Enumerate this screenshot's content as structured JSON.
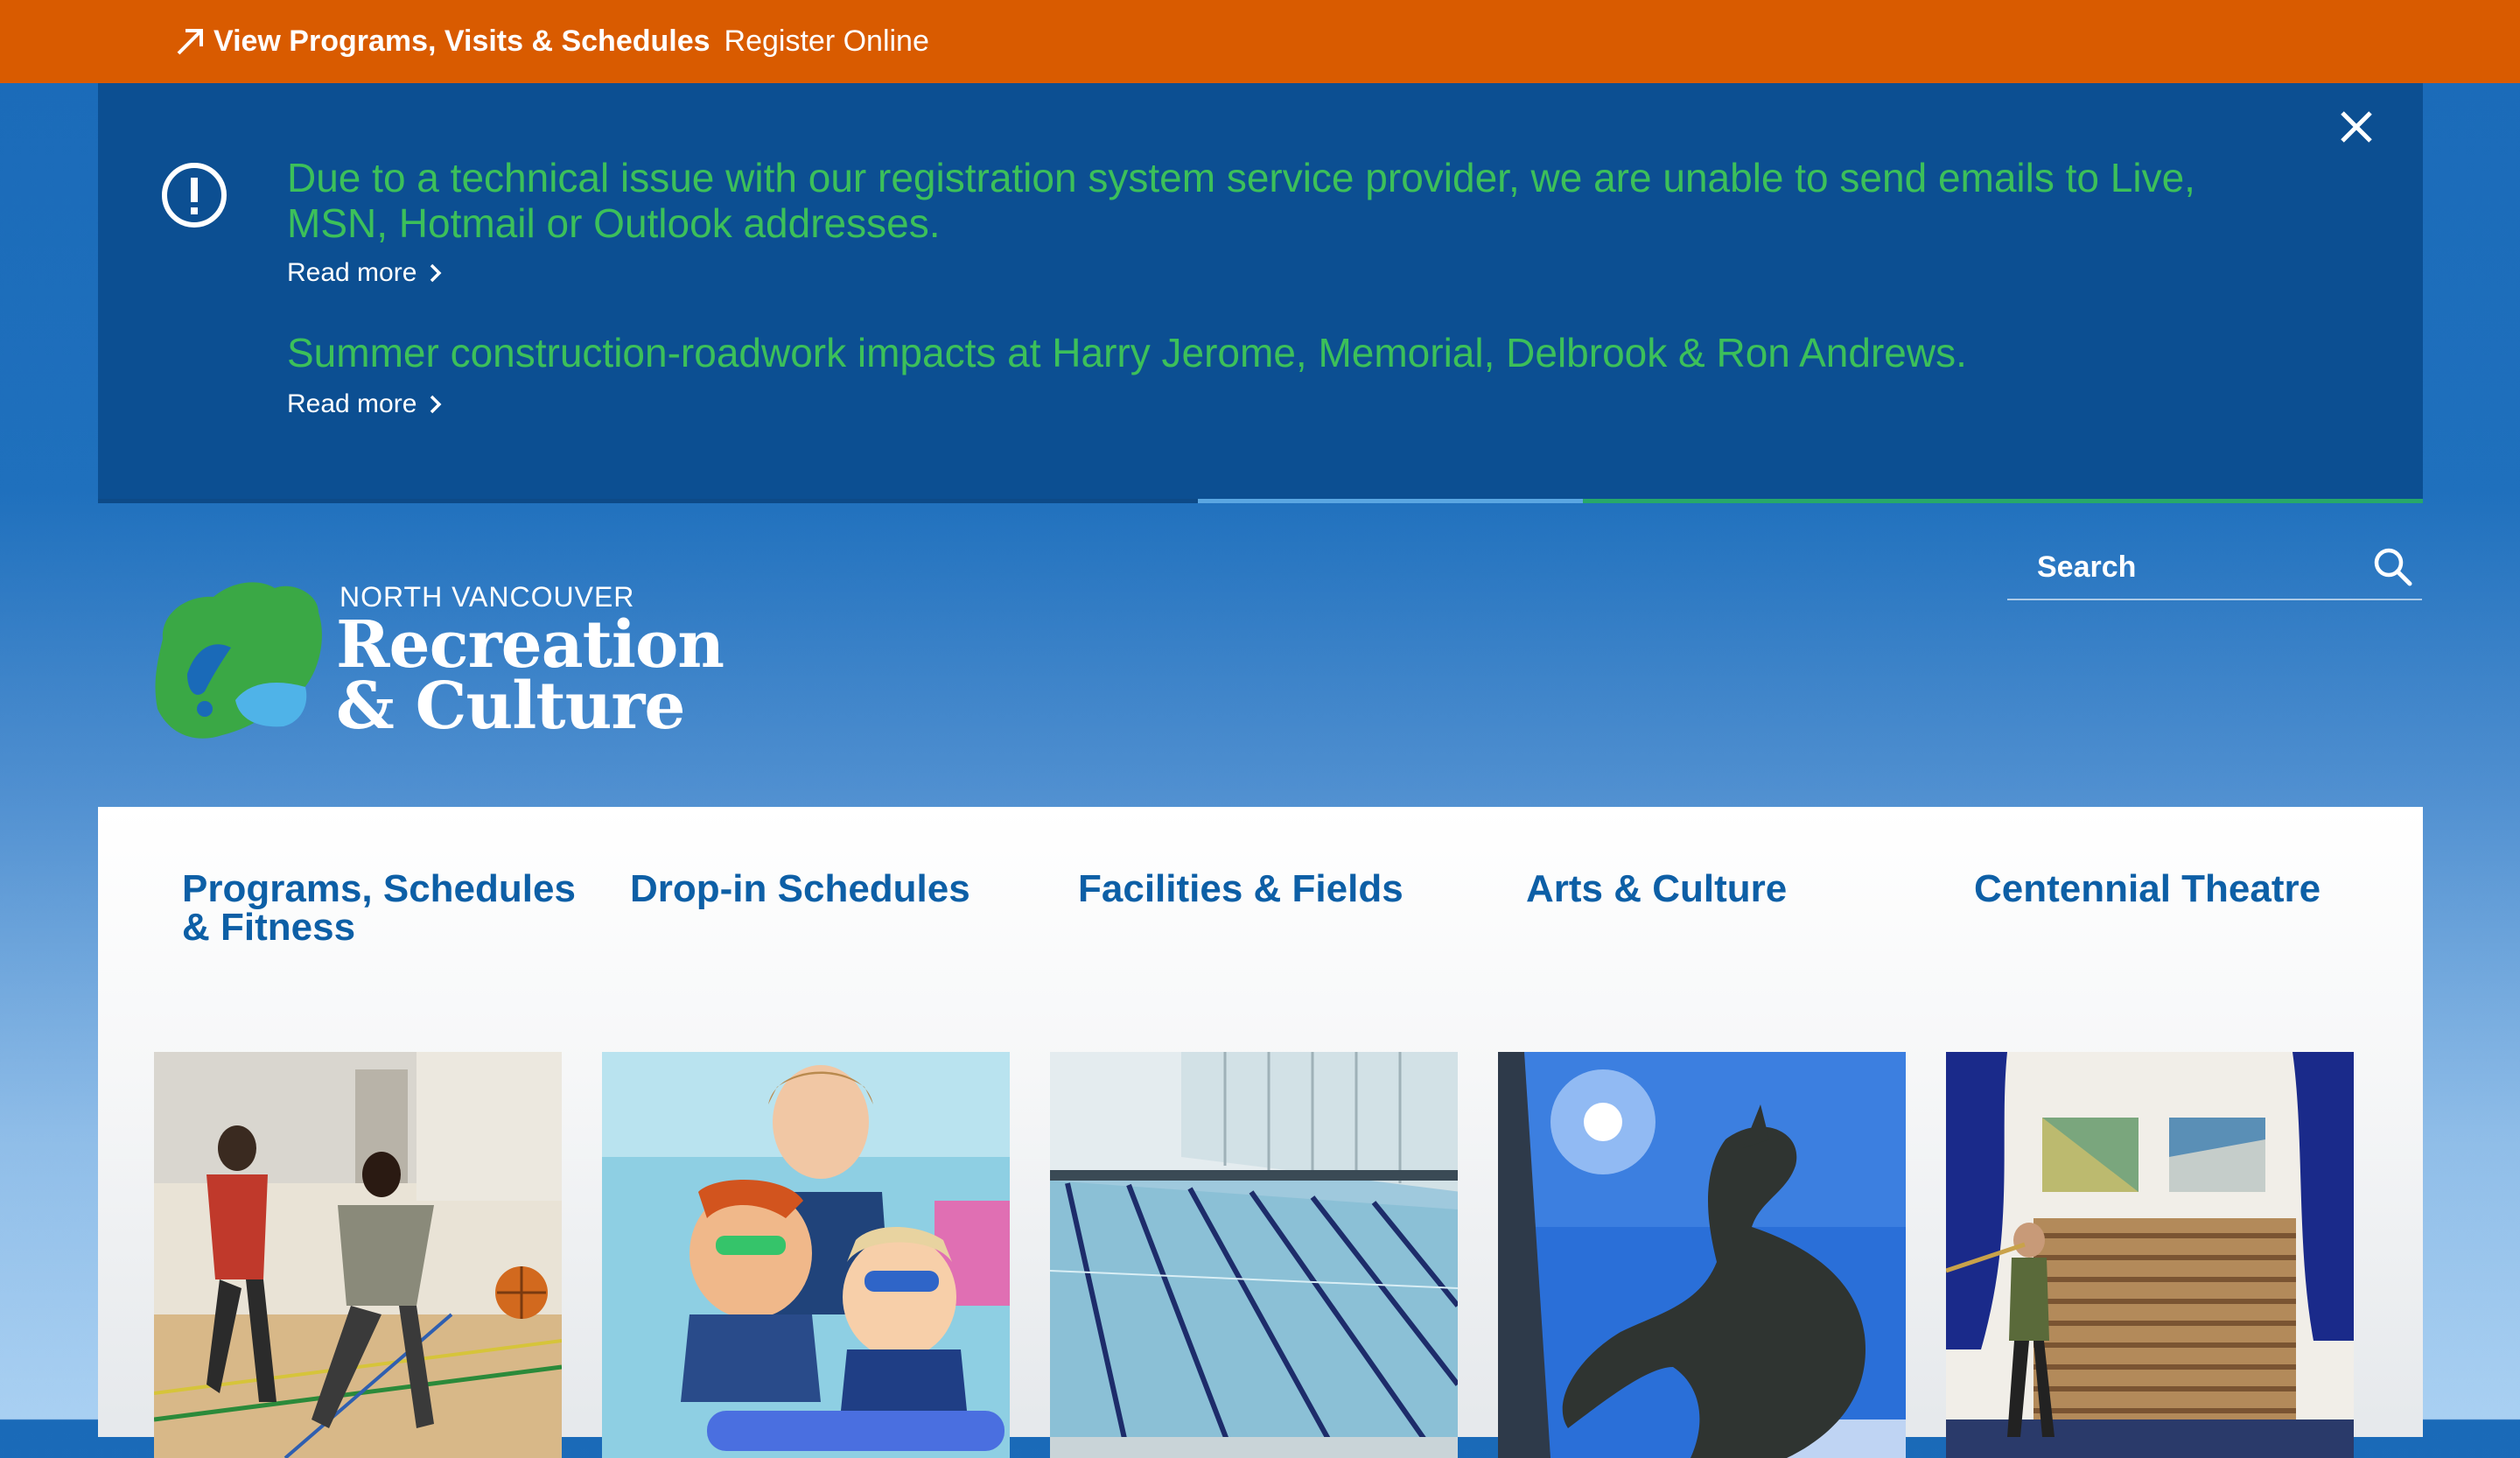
{
  "topbar": {
    "programs_label": "View Programs, Visits & Schedules",
    "register_label": "Register Online",
    "background": "#d95b00"
  },
  "alerts": {
    "background": "#0c4f92",
    "message_color": "#3cc05a",
    "items": [
      {
        "message": "Due to a technical issue with our registration system service provider, we are unable to send emails to Live, MSN, Hotmail or Outlook addresses.",
        "link": "Read more"
      },
      {
        "message": "Summer construction-roadwork impacts at Harry Jerome, Memorial, Delbrook & Ron Andrews.",
        "link": "Read more"
      }
    ],
    "close_icon": "close-icon",
    "info_icon": "exclamation-circle-icon"
  },
  "logo": {
    "line1": "NORTH VANCOUVER",
    "line2": "Recreation",
    "line3": "& Culture"
  },
  "search": {
    "placeholder": "Search",
    "icon": "search-icon"
  },
  "tiles": [
    {
      "label": "Programs, Schedules & Fitness"
    },
    {
      "label": "Drop-in Schedules"
    },
    {
      "label": "Facilities & Fields"
    },
    {
      "label": "Arts & Culture"
    },
    {
      "label": "Centennial Theatre"
    }
  ]
}
